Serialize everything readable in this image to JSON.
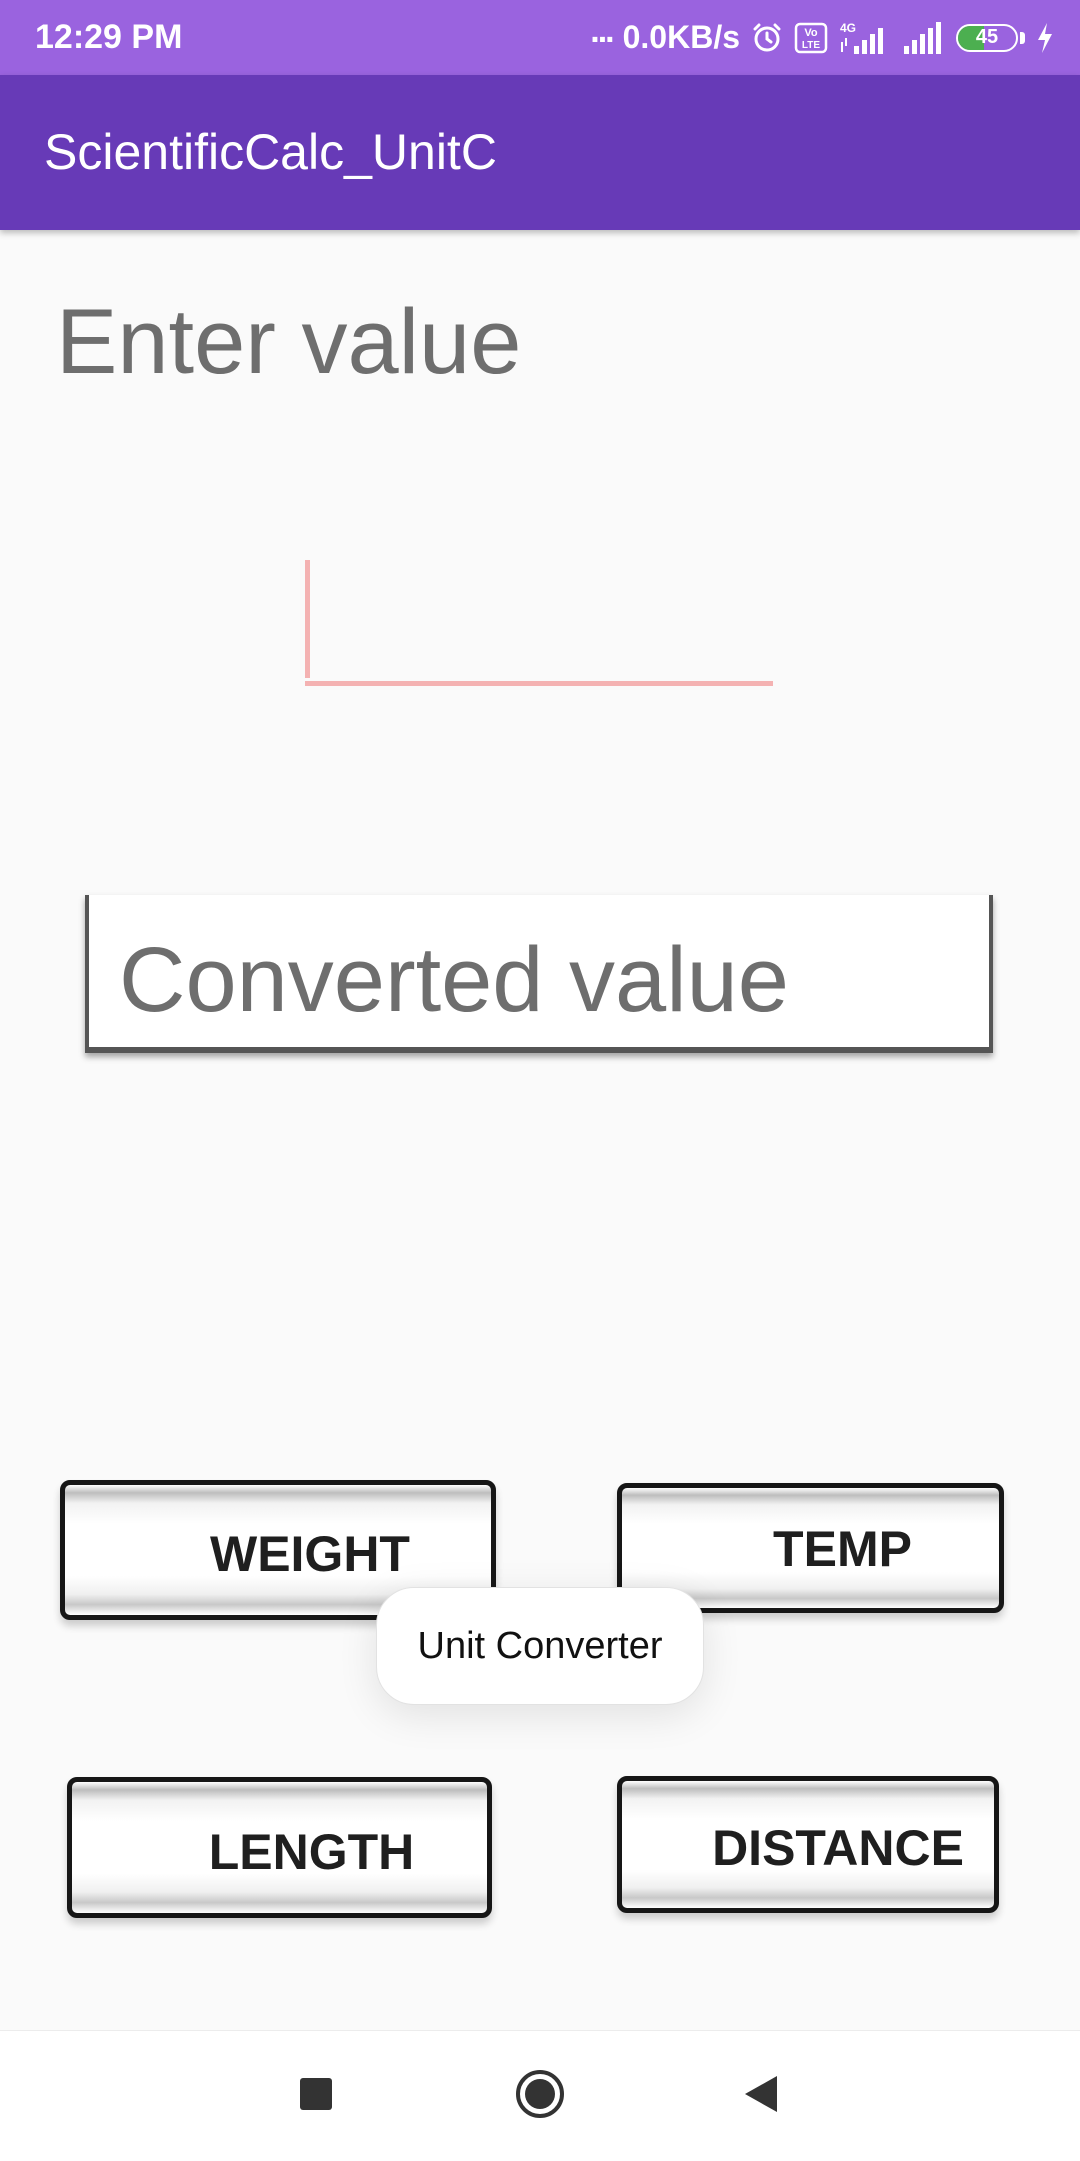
{
  "status_bar": {
    "time": "12:29 PM",
    "dots": "...",
    "network_speed": "0.0KB/s",
    "network_type": "4G",
    "volte": "Vo LTE",
    "battery_level": "45",
    "icons": [
      "alarm-icon",
      "volte-icon",
      "signal-4g-icon",
      "signal-icon",
      "battery-icon",
      "charging-icon"
    ]
  },
  "app_bar": {
    "title": "ScientificCalc_UnitC",
    "color": "#673ab7"
  },
  "main": {
    "enter_label": "Enter value",
    "input_value": "",
    "converted_placeholder": "Converted value"
  },
  "buttons": {
    "weight": "WEIGHT",
    "temp": "TEMP",
    "length": "LENGTH",
    "distance": "DISTANCE"
  },
  "toast": {
    "message": "Unit Converter"
  },
  "nav_bar": {
    "icons": [
      "recent-apps-icon",
      "home-icon",
      "back-icon"
    ]
  },
  "colors": {
    "status_bar": "#9a63df",
    "app_bar": "#673ab7",
    "background": "#fafafa",
    "accent_underline": "#f4b2b2",
    "battery_fill": "#4caf50"
  }
}
